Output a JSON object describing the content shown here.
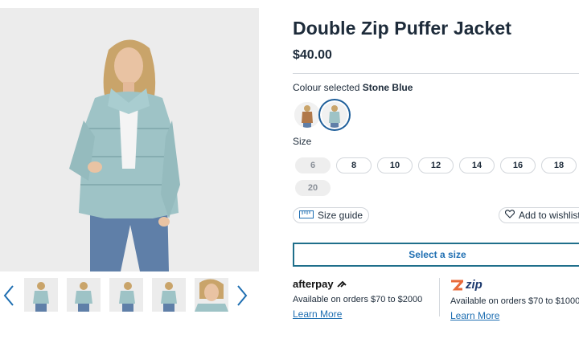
{
  "product": {
    "title": "Double Zip Puffer Jacket",
    "price": "$40.00"
  },
  "colour": {
    "prefix": "Colour selected",
    "selected": "Stone Blue",
    "swatches": [
      "Tan",
      "Stone Blue"
    ]
  },
  "size": {
    "label": "Size",
    "options": [
      {
        "label": "6",
        "available": false
      },
      {
        "label": "8",
        "available": true
      },
      {
        "label": "10",
        "available": true
      },
      {
        "label": "12",
        "available": true
      },
      {
        "label": "14",
        "available": true
      },
      {
        "label": "16",
        "available": true
      },
      {
        "label": "18",
        "available": true
      },
      {
        "label": "20",
        "available": false
      }
    ]
  },
  "actions": {
    "size_guide": "Size guide",
    "wishlist": "Add to wishlist",
    "select_size": "Select a size"
  },
  "payments": {
    "afterpay": {
      "brand": "afterpay",
      "text": "Available on orders $70 to $2000",
      "link": "Learn More"
    },
    "zip": {
      "brand": "zip",
      "text": "Available on orders $70 to $1000",
      "link": "Learn More"
    }
  },
  "colors": {
    "text": "#1d2b3a",
    "link": "#1f6fb2",
    "jacket": "#9ec3c6",
    "zip_brand": "#1d3a6e"
  },
  "icons": [
    "chevron-left-icon",
    "chevron-right-icon",
    "ruler-icon",
    "heart-icon",
    "afterpay-logo-icon",
    "zip-logo-icon"
  ]
}
